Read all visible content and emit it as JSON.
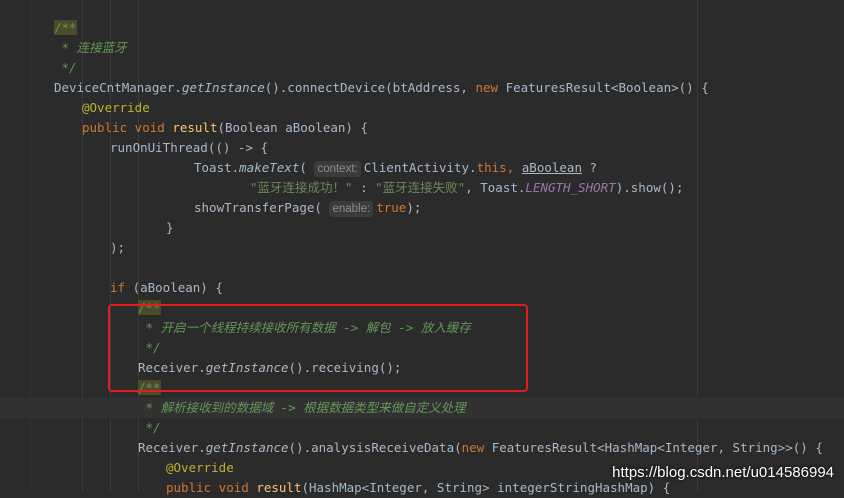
{
  "editor": {
    "lines": [
      {
        "t": [
          {
            "c": "c-doc-hl",
            "s": "/**"
          }
        ]
      },
      {
        "t": [
          {
            "c": "c-comment",
            "s": " * 连接蓝牙"
          }
        ]
      },
      {
        "t": [
          {
            "c": "c-comment",
            "s": " */"
          }
        ]
      },
      {
        "t": [
          {
            "c": "",
            "s": "DeviceCntManager."
          },
          {
            "c": "c-static",
            "s": "getInstance"
          },
          {
            "c": "",
            "s": "().connectDevice(btAddress, "
          },
          {
            "c": "c-kw",
            "s": "new "
          },
          {
            "c": "",
            "s": "FeaturesResult<Boolean>() {"
          }
        ]
      },
      {
        "t": [
          {
            "c": "c-ann",
            "s": "@Override"
          }
        ]
      },
      {
        "t": [
          {
            "c": "c-kw",
            "s": "public void "
          },
          {
            "c": "c-fn",
            "s": "result"
          },
          {
            "c": "",
            "s": "(Boolean aBoolean) {"
          }
        ]
      },
      {
        "t": [
          {
            "c": "",
            "s": "runOnUiThread(() -> {"
          }
        ]
      },
      {
        "t": [
          {
            "c": "",
            "s": "Toast."
          },
          {
            "c": "c-static",
            "s": "makeText"
          },
          {
            "c": "",
            "s": "( "
          },
          {
            "c": "hint",
            "s": "context:"
          },
          {
            "c": "",
            "s": "ClientActivity."
          },
          {
            "c": "c-kw",
            "s": "this"
          },
          {
            "c": "c-kw",
            "s": ", "
          },
          {
            "c": "c-param",
            "s": "aBoolean"
          },
          {
            "c": "",
            "s": " ?"
          }
        ]
      },
      {
        "t": [
          {
            "c": "c-str",
            "s": "\"蓝牙连接成功！\""
          },
          {
            "c": "",
            "s": " : "
          },
          {
            "c": "c-str",
            "s": "\"蓝牙连接失败\""
          },
          {
            "c": "",
            "s": ", Toast."
          },
          {
            "c": "c-field",
            "s": "LENGTH_SHORT"
          },
          {
            "c": "",
            "s": ").show();"
          }
        ]
      },
      {
        "t": [
          {
            "c": "",
            "s": "showTransferPage( "
          },
          {
            "c": "hint",
            "s": "enable:"
          },
          {
            "c": "c-kw",
            "s": "true"
          },
          {
            "c": "",
            "s": ");"
          }
        ]
      },
      {
        "t": [
          {
            "c": "",
            "s": "}"
          }
        ]
      },
      {
        "t": [
          {
            "c": "",
            "s": ");"
          }
        ]
      },
      {
        "t": []
      },
      {
        "t": [
          {
            "c": "c-kw",
            "s": "if "
          },
          {
            "c": "",
            "s": "(aBoolean) {"
          }
        ]
      },
      {
        "t": [
          {
            "c": "c-doc-hl",
            "s": "/**"
          }
        ]
      },
      {
        "t": [
          {
            "c": "c-comment",
            "s": " * 开启一个线程持续接收所有数据 -> 解包 -> 放入缓存"
          }
        ]
      },
      {
        "t": [
          {
            "c": "c-comment",
            "s": " */"
          }
        ]
      },
      {
        "t": [
          {
            "c": "",
            "s": "Receiver."
          },
          {
            "c": "c-static",
            "s": "getInstance"
          },
          {
            "c": "",
            "s": "().receiving();"
          }
        ]
      },
      {
        "t": [
          {
            "c": "c-doc-hl",
            "s": "/**"
          }
        ]
      },
      {
        "t": [
          {
            "c": "c-comment",
            "s": " * 解析接收到的数据域 -> 根据数据类型来做自定义处理"
          }
        ]
      },
      {
        "t": [
          {
            "c": "c-comment",
            "s": " */"
          }
        ]
      },
      {
        "t": [
          {
            "c": "",
            "s": "Receiver."
          },
          {
            "c": "c-static",
            "s": "getInstance"
          },
          {
            "c": "",
            "s": "().analysisReceiveData("
          },
          {
            "c": "c-kw",
            "s": "new "
          },
          {
            "c": "",
            "s": "FeaturesResult<HashMap<Integer, String>>() {"
          }
        ]
      },
      {
        "t": [
          {
            "c": "c-ann",
            "s": "@Override"
          }
        ]
      },
      {
        "t": [
          {
            "c": "c-kw",
            "s": "public void "
          },
          {
            "c": "c-fn",
            "s": "result"
          },
          {
            "c": "",
            "s": "(HashMap<Integer, String> integerStringHashMap) {"
          }
        ]
      }
    ]
  },
  "watermark": "https://blog.csdn.net/u014586994"
}
